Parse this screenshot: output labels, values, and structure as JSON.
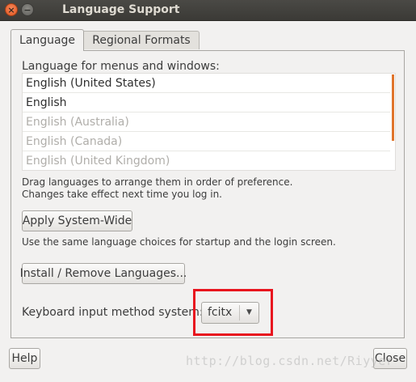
{
  "window": {
    "title": "Language Support",
    "close_glyph": "×",
    "minimize_glyph": "−"
  },
  "tabs": [
    {
      "label": "Language",
      "selected": true
    },
    {
      "label": "Regional Formats",
      "selected": false
    }
  ],
  "language_tab": {
    "list_heading": "Language for menus and windows:",
    "languages": [
      {
        "label": "English (United States)",
        "enabled": true
      },
      {
        "label": "English",
        "enabled": true
      },
      {
        "label": "English (Australia)",
        "enabled": false
      },
      {
        "label": "English (Canada)",
        "enabled": false
      },
      {
        "label": "English (United Kingdom)",
        "enabled": false
      }
    ],
    "hint_line1": "Drag languages to arrange them in order of preference.",
    "hint_line2": "Changes take effect next time you log in.",
    "apply_button": "Apply System-Wide",
    "apply_hint": "Use the same language choices for startup and the login screen.",
    "install_button": "Install / Remove Languages...",
    "input_method_label": "Keyboard input method system:",
    "input_method_value": "fcitx"
  },
  "footer": {
    "help_button": "Help",
    "close_button": "Close"
  },
  "watermark": "http://blog.csdn.net/Riyyer",
  "colors": {
    "titlebar": "#3c3b37",
    "scroll_accent": "#e0742b",
    "highlight_box": "#e8141e"
  }
}
